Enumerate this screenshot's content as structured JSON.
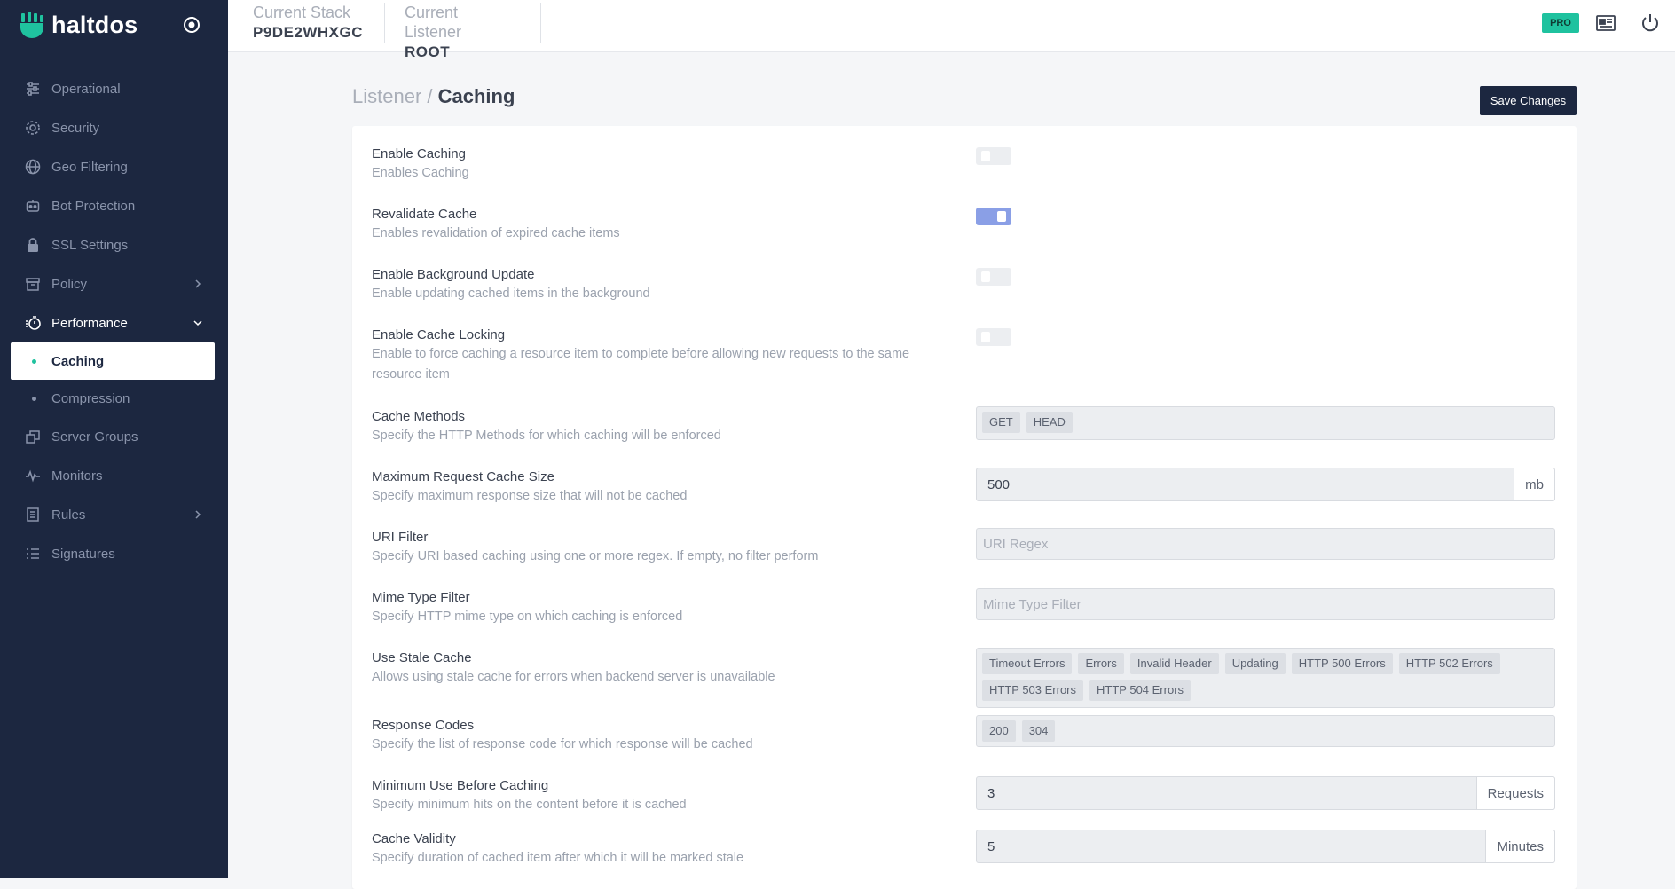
{
  "brand": {
    "name": "haltdos"
  },
  "sidebar": {
    "items": [
      {
        "label": "Operational",
        "icon": "sliders-icon"
      },
      {
        "label": "Security",
        "icon": "gear-icon"
      },
      {
        "label": "Geo Filtering",
        "icon": "globe-icon"
      },
      {
        "label": "Bot Protection",
        "icon": "robot-icon"
      },
      {
        "label": "SSL Settings",
        "icon": "lock-icon"
      },
      {
        "label": "Policy",
        "icon": "archive-icon"
      },
      {
        "label": "Performance",
        "icon": "stopwatch-icon"
      },
      {
        "label": "Caching"
      },
      {
        "label": "Compression"
      },
      {
        "label": "Server Groups",
        "icon": "server-group-icon"
      },
      {
        "label": "Monitors",
        "icon": "pulse-icon"
      },
      {
        "label": "Rules",
        "icon": "rules-icon"
      },
      {
        "label": "Signatures",
        "icon": "list-icon"
      }
    ]
  },
  "header": {
    "stack_label": "Current Stack",
    "stack_value": "P9DE2WHXGC",
    "listener_label": "Current Listener",
    "listener_value": "ROOT",
    "badge": "PRO"
  },
  "breadcrumb": {
    "parent": "Listener",
    "separator": " / ",
    "current": "Caching"
  },
  "save_label": "Save Changes",
  "settings": {
    "enable_caching": {
      "label": "Enable Caching",
      "desc": "Enables Caching",
      "on": false
    },
    "revalidate_cache": {
      "label": "Revalidate Cache",
      "desc": "Enables revalidation of expired cache items",
      "on": true
    },
    "background_update": {
      "label": "Enable Background Update",
      "desc": "Enable updating cached items in the background",
      "on": false
    },
    "cache_locking": {
      "label": "Enable Cache Locking",
      "desc": "Enable to force caching a resource item to complete before allowing new requests to the same resource item",
      "on": false
    },
    "cache_methods": {
      "label": "Cache Methods",
      "desc": "Specify the HTTP Methods for which caching will be enforced",
      "tags": [
        "GET",
        "HEAD"
      ]
    },
    "max_request_size": {
      "label": "Maximum Request Cache Size",
      "desc": "Specify maximum response size that will not be cached",
      "value": "500",
      "unit": "mb"
    },
    "uri_filter": {
      "label": "URI Filter",
      "desc": "Specify URI based caching using one or more regex. If empty, no filter perform",
      "placeholder": "URI Regex"
    },
    "mime_filter": {
      "label": "Mime Type Filter",
      "desc": "Specify HTTP mime type on which caching is enforced",
      "placeholder": "Mime Type Filter"
    },
    "stale_cache": {
      "label": "Use Stale Cache",
      "desc": "Allows using stale cache for errors when backend server is unavailable",
      "tags": [
        "Timeout Errors",
        "Errors",
        "Invalid Header",
        "Updating",
        "HTTP 500 Errors",
        "HTTP 502 Errors",
        "HTTP 503 Errors",
        "HTTP 504 Errors"
      ]
    },
    "response_codes": {
      "label": "Response Codes",
      "desc": "Specify the list of response code for which response will be cached",
      "tags": [
        "200",
        "304"
      ]
    },
    "min_use": {
      "label": "Minimum Use Before Caching",
      "desc": "Specify minimum hits on the content before it is cached",
      "value": "3",
      "unit": "Requests"
    },
    "cache_validity": {
      "label": "Cache Validity",
      "desc": "Specify duration of cached item after which it will be marked stale",
      "value": "5",
      "unit": "Minutes"
    }
  }
}
